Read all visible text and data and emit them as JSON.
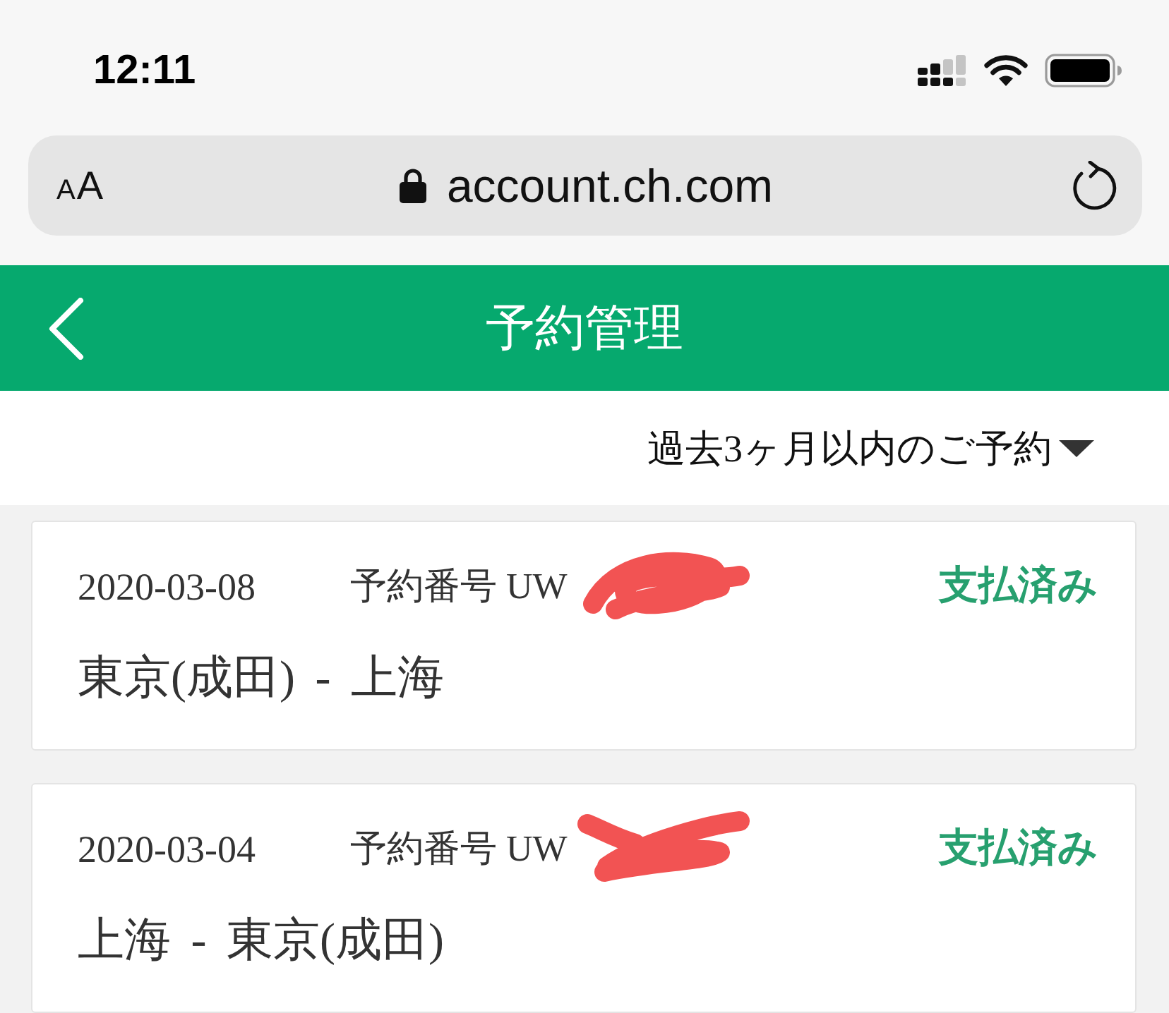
{
  "status_bar": {
    "time": "12:11"
  },
  "browser": {
    "text_size_small": "A",
    "text_size_large": "A",
    "url": "account.ch.com"
  },
  "header": {
    "title": "予約管理"
  },
  "filter": {
    "label": "過去3ヶ月以内のご予約"
  },
  "reservations": [
    {
      "date": "2020-03-08",
      "number": "予約番号 UW",
      "redacted": true,
      "status": "支払済み",
      "route": "東京(成田) - 上海"
    },
    {
      "date": "2020-03-04",
      "number": "予約番号 UW",
      "redacted": true,
      "status": "支払済み",
      "route": "上海 - 東京(成田)"
    }
  ]
}
